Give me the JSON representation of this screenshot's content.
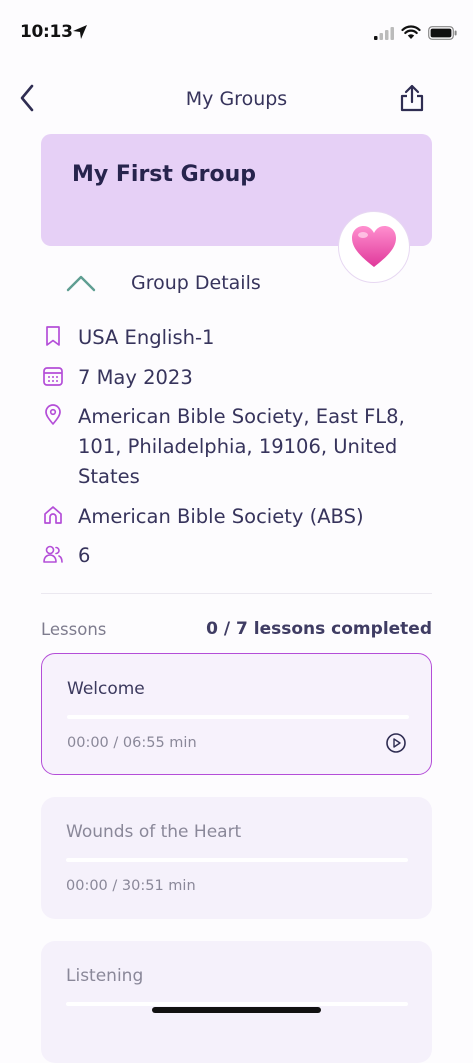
{
  "status_bar": {
    "time": "10:13"
  },
  "nav": {
    "title": "My Groups"
  },
  "group": {
    "name": "My First Group",
    "badge_emoji": "💗"
  },
  "details": {
    "toggle_label": "Group Details",
    "language": "USA English-1",
    "date": "7 May 2023",
    "address": "American Bible Society, East FL8, 101, Philadelphia, 19106, United States",
    "organization": "American Bible Society (ABS)",
    "members": "6"
  },
  "lessons": {
    "label": "Lessons",
    "progress": "0 / 7 lessons completed",
    "items": [
      {
        "title": "Welcome",
        "time": "00:00 / 06:55 min",
        "progress": 0
      },
      {
        "title": "Wounds of the Heart",
        "time": "00:00 / 30:51 min",
        "progress": 0
      },
      {
        "title": "Listening",
        "time": "",
        "progress": 0
      }
    ]
  },
  "colors": {
    "accent": "#b44ed8",
    "card": "#e6d0f6",
    "chevron": "#5f9e92"
  }
}
